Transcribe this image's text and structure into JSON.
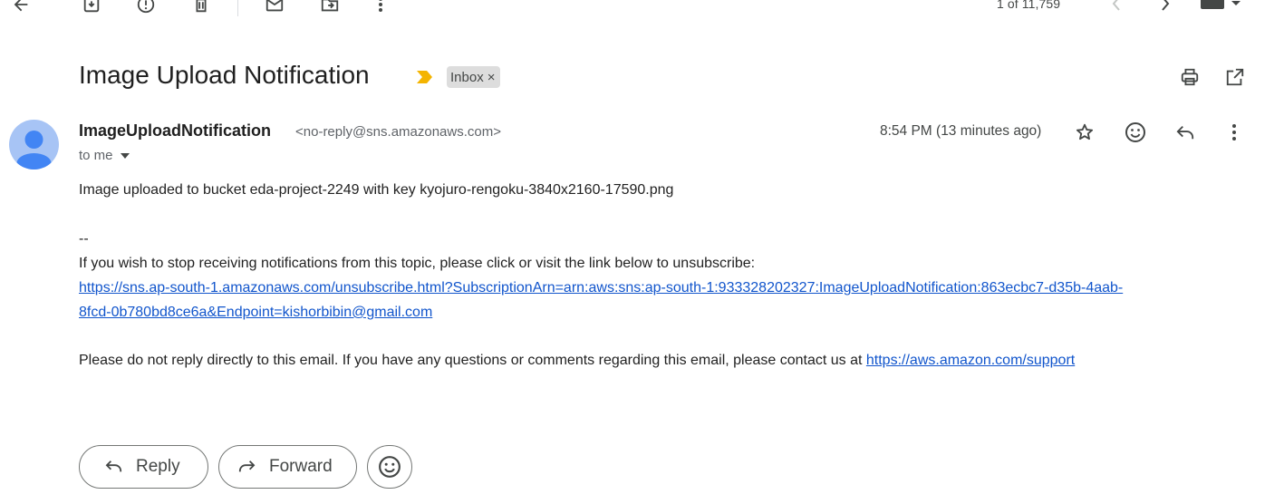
{
  "toolbar": {
    "icons": [
      "back-arrow-icon",
      "archive-icon",
      "report-spam-icon",
      "delete-icon",
      "mark-unread-icon",
      "move-to-icon",
      "more-vert-icon"
    ],
    "pager_text": "1 of 11,759"
  },
  "email": {
    "subject": "Image Upload Notification",
    "label": "Inbox",
    "label_remove": "×",
    "sender_name": "ImageUploadNotification",
    "sender_email": "<no-reply@sns.amazonaws.com>",
    "recipient": "to me",
    "time": "8:54 PM (13 minutes ago)",
    "body": {
      "line1": "Image uploaded to bucket eda-project-2249 with key kyojuro-rengoku-3840x2160-17590.png",
      "separator": "--",
      "unsub_intro": "If you wish to stop receiving notifications from this topic, please click or visit the link below to unsubscribe:",
      "unsub_link_part1": "https://sns.ap-south-1.amazonaws.com/unsubscribe.html?SubscriptionArn=arn:aws:sns:ap-south-1:933328202327:ImageUploadNotification:863ecbc7-d35b-4aab-",
      "unsub_link_part2": "8fcd-0b780bd8ce6a&Endpoint=kishorbibin@gmail.com",
      "footer_text": "Please do not reply directly to this email. If you have any questions or comments regarding this email, please contact us at ",
      "support_link": "https://aws.amazon.com/support"
    }
  },
  "actions": {
    "reply_label": "Reply",
    "forward_label": "Forward"
  },
  "colors": {
    "link": "#1155cc",
    "important_marker": "#f4b400",
    "avatar_bg": "#a7c4f5",
    "avatar_fg": "#4285f4"
  }
}
